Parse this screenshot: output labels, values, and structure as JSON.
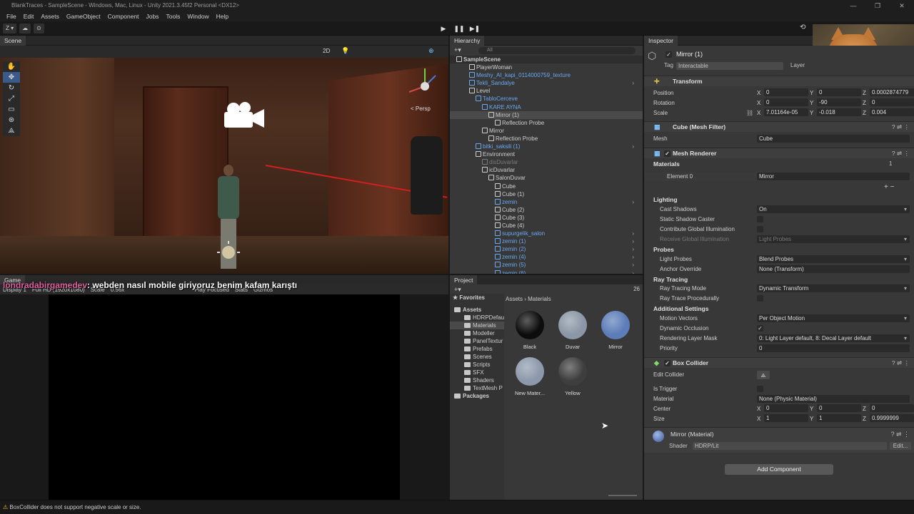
{
  "window": {
    "title": "BlankTraces - SampleScene - Windows, Mac, Linux - Unity 2021.3.45f2 Personal <DX12>",
    "controls": [
      "—",
      "❐",
      "✕"
    ]
  },
  "menu": [
    "File",
    "Edit",
    "Assets",
    "GameObject",
    "Component",
    "Jobs",
    "Tools",
    "Window",
    "Help"
  ],
  "toolbar": {
    "account": "Z ▾",
    "play": "▶",
    "pause": "❚❚",
    "step": "▶❚"
  },
  "scene_panel": {
    "tab": "Scene",
    "toggle_2d": "2D",
    "persp_label": "< Persp"
  },
  "game_panel": {
    "tab": "Game",
    "display": "Display 1",
    "resolution": "Full HD (1920x1080)",
    "scale_label": "Scale",
    "scale_value": "0.56x",
    "play_mode": "Play Focused",
    "stats": "Stats",
    "gizmos": "Gizmos"
  },
  "chat_overlay": {
    "user": "londradabirgamedev",
    "message": ": webden nasıl mobile giriyoruz benim kafam karıştı"
  },
  "hierarchy": {
    "tab": "Hierarchy",
    "search_placeholder": "All",
    "rows": [
      {
        "label": "SampleScene",
        "style": "scene",
        "indent": 1
      },
      {
        "label": "PlayerWoman",
        "style": "normal",
        "indent": 3
      },
      {
        "label": "Meshy_AI_kapi_0114000759_texture",
        "style": "blue",
        "indent": 3
      },
      {
        "label": "Tekli_Sandalye",
        "style": "blue",
        "indent": 3,
        "arrow": true
      },
      {
        "label": "Level",
        "style": "normal",
        "indent": 3
      },
      {
        "label": "TabloCerceve",
        "style": "blue",
        "indent": 4
      },
      {
        "label": "KARE AYNA",
        "style": "blue",
        "indent": 5
      },
      {
        "label": "Mirror (1)",
        "style": "sel",
        "indent": 6
      },
      {
        "label": "Reflection Probe",
        "style": "normal",
        "indent": 7
      },
      {
        "label": "Mirror",
        "style": "normal",
        "indent": 5
      },
      {
        "label": "Reflection Probe",
        "style": "normal",
        "indent": 6
      },
      {
        "label": "bitki_saksili (1)",
        "style": "blue",
        "indent": 4,
        "arrow": true
      },
      {
        "label": "Environment",
        "style": "normal",
        "indent": 4
      },
      {
        "label": "disDuvarlar",
        "style": "grey",
        "indent": 5
      },
      {
        "label": "icDuvarlar",
        "style": "normal",
        "indent": 5
      },
      {
        "label": "SalonDuvar",
        "style": "normal",
        "indent": 6
      },
      {
        "label": "Cube",
        "style": "normal",
        "indent": 7
      },
      {
        "label": "Cube (1)",
        "style": "normal",
        "indent": 7
      },
      {
        "label": "zemin",
        "style": "blue",
        "indent": 7,
        "arrow": true
      },
      {
        "label": "Cube (2)",
        "style": "normal",
        "indent": 7
      },
      {
        "label": "Cube (3)",
        "style": "normal",
        "indent": 7
      },
      {
        "label": "Cube (4)",
        "style": "normal",
        "indent": 7
      },
      {
        "label": "supurgelik_salon",
        "style": "blue",
        "indent": 7,
        "arrow": true
      },
      {
        "label": "zemin (1)",
        "style": "blue",
        "indent": 7,
        "arrow": true
      },
      {
        "label": "zemin (2)",
        "style": "blue",
        "indent": 7,
        "arrow": true
      },
      {
        "label": "zemin (4)",
        "style": "blue",
        "indent": 7,
        "arrow": true
      },
      {
        "label": "zemin (5)",
        "style": "blue",
        "indent": 7,
        "arrow": true
      },
      {
        "label": "zemin (6)",
        "style": "blue",
        "indent": 7,
        "arrow": true
      }
    ]
  },
  "project": {
    "tab": "Project",
    "count": "26",
    "breadcrumb": [
      "Assets",
      "Materials"
    ],
    "favorites": "Favorites",
    "tree": [
      {
        "label": "Assets",
        "indent": 0,
        "bold": true
      },
      {
        "label": "HDRPDefau",
        "indent": 1
      },
      {
        "label": "Materials",
        "indent": 1,
        "sel": true
      },
      {
        "label": "Modeller",
        "indent": 1
      },
      {
        "label": "PanelTextur",
        "indent": 1
      },
      {
        "label": "Prefabs",
        "indent": 1
      },
      {
        "label": "Scenes",
        "indent": 1
      },
      {
        "label": "Scripts",
        "indent": 1
      },
      {
        "label": "SFX",
        "indent": 1
      },
      {
        "label": "Shaders",
        "indent": 1
      },
      {
        "label": "TextMesh P",
        "indent": 1
      },
      {
        "label": "Packages",
        "indent": 0,
        "bold": true
      }
    ],
    "materials": [
      {
        "name": "Black",
        "color": "#0c0c0c"
      },
      {
        "name": "Duvar",
        "color": "#8b97a6"
      },
      {
        "name": "Mirror",
        "color": "#5c7db8"
      },
      {
        "name": "New Mater...",
        "color": "#8c99ab"
      },
      {
        "name": "Yellow",
        "color": "#3e3e3e"
      }
    ]
  },
  "inspector": {
    "tab": "Inspector",
    "object_name": "Mirror (1)",
    "tag_label": "Tag",
    "tag_value": "Interactable",
    "layer_label": "Layer",
    "transform": {
      "title": "Transform",
      "position_label": "Position",
      "position": [
        "0",
        "0",
        "0.0002874779"
      ],
      "rotation_label": "Rotation",
      "rotation": [
        "0",
        "-90",
        "0"
      ],
      "scale_label": "Scale",
      "scale": [
        "7.01164e-05",
        "-0.018",
        "0.004"
      ]
    },
    "mesh_filter": {
      "title": "Cube (Mesh Filter)",
      "mesh_label": "Mesh",
      "mesh_value": "Cube"
    },
    "mesh_renderer": {
      "title": "Mesh Renderer",
      "materials_label": "Materials",
      "materials_count": "1",
      "element_label": "Element 0",
      "element_value": "Mirror",
      "lighting": "Lighting",
      "cast_shadows_label": "Cast Shadows",
      "cast_shadows_value": "On",
      "static_shadow_label": "Static Shadow Caster",
      "contribute_gi_label": "Contribute Global Illumination",
      "receive_gi_label": "Receive Global Illumination",
      "receive_gi_value": "Light Probes",
      "probes": "Probes",
      "light_probes_label": "Light Probes",
      "light_probes_value": "Blend Probes",
      "anchor_label": "Anchor Override",
      "anchor_value": "None (Transform)",
      "ray_tracing": "Ray Tracing",
      "rt_mode_label": "Ray Tracing Mode",
      "rt_mode_value": "Dynamic Transform",
      "rt_proc_label": "Ray Trace Procedurally",
      "additional": "Additional Settings",
      "motion_label": "Motion Vectors",
      "motion_value": "Per Object Motion",
      "dyn_occ_label": "Dynamic Occlusion",
      "layer_mask_label": "Rendering Layer Mask",
      "layer_mask_value": "0: Light Layer default, 8: Decal Layer default",
      "priority_label": "Priority",
      "priority_value": "0"
    },
    "box_collider": {
      "title": "Box Collider",
      "edit_label": "Edit Collider",
      "trigger_label": "Is Trigger",
      "material_label": "Material",
      "material_value": "None (Physic Material)",
      "center_label": "Center",
      "center": [
        "0",
        "0",
        "0"
      ],
      "size_label": "Size",
      "size": [
        "1",
        "1",
        "0.9999999"
      ]
    },
    "material": {
      "title": "Mirror (Material)",
      "shader_label": "Shader",
      "shader_value": "HDRP/Lit",
      "edit": "Edit..."
    },
    "add_component": "Add Component"
  },
  "status": {
    "message": "BoxCollider does not support negative scale or size."
  }
}
